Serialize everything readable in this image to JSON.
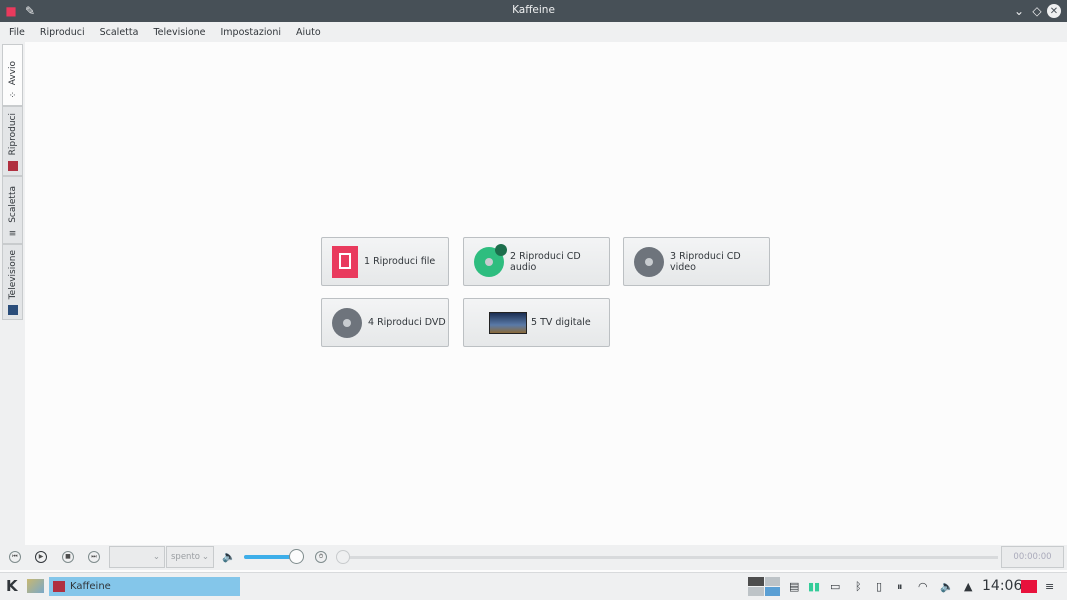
{
  "window": {
    "title": "Kaffeine"
  },
  "menu": [
    "File",
    "Riproduci",
    "Scaletta",
    "Televisione",
    "Impostazioni",
    "Aiuto"
  ],
  "side_tabs": [
    "Avvio",
    "Riproduci",
    "Scaletta",
    "Televisione"
  ],
  "start_buttons": [
    {
      "label": "1 Riproduci file",
      "icon": "file-video-icon",
      "color": "#e93a5d"
    },
    {
      "label": "2 Riproduci CD audio",
      "icon": "audio-cd-icon",
      "color": "#2ebd7f"
    },
    {
      "label": "3 Riproduci CD video",
      "icon": "video-cd-icon",
      "color": "#6e747c"
    },
    {
      "label": "4 Riproduci DVD",
      "icon": "dvd-icon",
      "color": "#6e747c"
    },
    {
      "label": "5 TV digitale",
      "icon": "tv-icon",
      "color": "#2a4d7a"
    }
  ],
  "controls": {
    "audio_channel": "",
    "subtitle": "spento",
    "volume_percent": 87,
    "seek_percent": 0,
    "time": "00:00:00"
  },
  "taskbar": {
    "task": "Kaffeine",
    "clock": "14:06"
  }
}
